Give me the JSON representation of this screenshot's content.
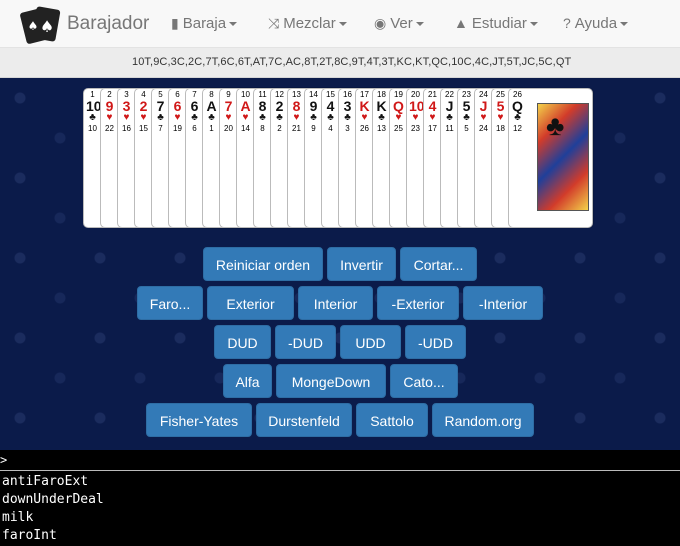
{
  "app": {
    "title": "Barajador"
  },
  "nav": [
    {
      "label": "Baraja",
      "icon": "book-icon"
    },
    {
      "label": "Mezclar",
      "icon": "shuffle-icon"
    },
    {
      "label": "Ver",
      "icon": "eye-icon"
    },
    {
      "label": "Estudiar",
      "icon": "graduation-cap-icon"
    },
    {
      "label": "Ayuda",
      "icon": "question-circle-icon"
    }
  ],
  "sequence": "10T,9C,3C,2C,7T,6C,6T,AT,7C,AC,8T,2T,8C,9T,4T,3T,KC,KT,QC,10C,4C,JT,5T,JC,5C,QT",
  "cards": [
    {
      "pos": "1",
      "rank": "10",
      "suit": "♣",
      "num": "10",
      "color": "blk"
    },
    {
      "pos": "2",
      "rank": "9",
      "suit": "♥",
      "num": "22",
      "color": "red"
    },
    {
      "pos": "3",
      "rank": "3",
      "suit": "♥",
      "num": "16",
      "color": "red"
    },
    {
      "pos": "4",
      "rank": "2",
      "suit": "♥",
      "num": "15",
      "color": "red"
    },
    {
      "pos": "5",
      "rank": "7",
      "suit": "♣",
      "num": "7",
      "color": "blk"
    },
    {
      "pos": "6",
      "rank": "6",
      "suit": "♥",
      "num": "19",
      "color": "red"
    },
    {
      "pos": "7",
      "rank": "6",
      "suit": "♣",
      "num": "6",
      "color": "blk"
    },
    {
      "pos": "8",
      "rank": "A",
      "suit": "♣",
      "num": "1",
      "color": "blk"
    },
    {
      "pos": "9",
      "rank": "7",
      "suit": "♥",
      "num": "20",
      "color": "red"
    },
    {
      "pos": "10",
      "rank": "A",
      "suit": "♥",
      "num": "14",
      "color": "red"
    },
    {
      "pos": "11",
      "rank": "8",
      "suit": "♣",
      "num": "8",
      "color": "blk"
    },
    {
      "pos": "12",
      "rank": "2",
      "suit": "♣",
      "num": "2",
      "color": "blk"
    },
    {
      "pos": "13",
      "rank": "8",
      "suit": "♥",
      "num": "21",
      "color": "red"
    },
    {
      "pos": "14",
      "rank": "9",
      "suit": "♣",
      "num": "9",
      "color": "blk"
    },
    {
      "pos": "15",
      "rank": "4",
      "suit": "♣",
      "num": "4",
      "color": "blk"
    },
    {
      "pos": "16",
      "rank": "3",
      "suit": "♣",
      "num": "3",
      "color": "blk"
    },
    {
      "pos": "17",
      "rank": "K",
      "suit": "♥",
      "num": "26",
      "color": "red"
    },
    {
      "pos": "18",
      "rank": "K",
      "suit": "♣",
      "num": "13",
      "color": "blk"
    },
    {
      "pos": "19",
      "rank": "Q",
      "suit": "♥",
      "num": "25",
      "color": "red"
    },
    {
      "pos": "20",
      "rank": "10",
      "suit": "♥",
      "num": "23",
      "color": "red"
    },
    {
      "pos": "21",
      "rank": "4",
      "suit": "♥",
      "num": "17",
      "color": "red"
    },
    {
      "pos": "22",
      "rank": "J",
      "suit": "♣",
      "num": "11",
      "color": "blk"
    },
    {
      "pos": "23",
      "rank": "5",
      "suit": "♣",
      "num": "5",
      "color": "blk"
    },
    {
      "pos": "24",
      "rank": "J",
      "suit": "♥",
      "num": "24",
      "color": "red"
    },
    {
      "pos": "25",
      "rank": "5",
      "suit": "♥",
      "num": "18",
      "color": "red"
    },
    {
      "pos": "26",
      "rank": "Q",
      "suit": "♣",
      "num": "12",
      "color": "blk"
    }
  ],
  "buttons": {
    "row1": [
      "Reiniciar orden",
      "Invertir",
      "Cortar..."
    ],
    "row2": [
      "Faro...",
      "Exterior",
      "Interior",
      "-Exterior",
      "-Interior"
    ],
    "row3": [
      "DUD",
      "-DUD",
      "UDD",
      "-UDD"
    ],
    "row4": [
      "Alfa",
      "MongeDown",
      "Cato..."
    ],
    "row5": [
      "Fisher-Yates",
      "Durstenfeld",
      "Sattolo",
      "Random.org"
    ]
  },
  "console": {
    "prompt": ">",
    "lines": [
      "antiFaroExt",
      "downUnderDeal",
      "milk",
      "faroInt"
    ]
  },
  "colors": {
    "button": "#337ab7",
    "red_suit": "#d01818",
    "table_bg": "#0b1b4a"
  }
}
